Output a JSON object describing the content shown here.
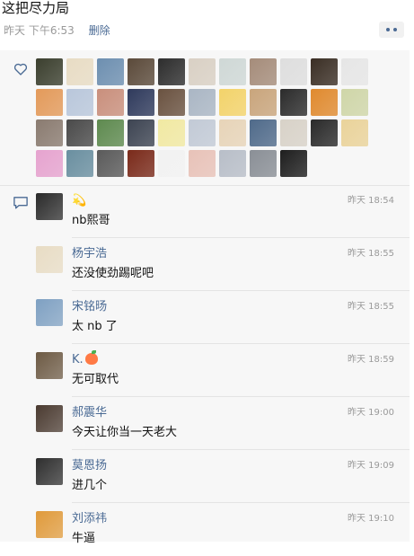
{
  "post": {
    "text": "这把尽力局",
    "time": "昨天 下午6:53",
    "delete_label": "删除"
  },
  "likes": {
    "icon": "heart-icon",
    "avatar_colors": [
      "#3b3f2e",
      "#e8dcc4",
      "#6d8fb0",
      "#5b4a3a",
      "#2d2d2d",
      "#d9d0c4",
      "#cfd8d6",
      "#a58c7a",
      "#dedede",
      "#3a2e24",
      "#e6e6e6",
      "#e39a5a",
      "#b9c7db",
      "#c98f7c",
      "#2f3a5c",
      "#6a5240",
      "#aab6c4",
      "#f3d36a",
      "#c9a57c",
      "#2b2b2b",
      "#e08a2e",
      "#cfd6a8",
      "#8a7b70",
      "#4a4a4a",
      "#5e8a4f",
      "#3d4452",
      "#f1e9a2",
      "#c2cad6",
      "#e7d4b8",
      "#4f6a8a",
      "#d8d2c8",
      "#2a2a2a",
      "#ead39a",
      "#e6a3cf",
      "#6a8fa0",
      "#5a5a5a",
      "#7a2a1a",
      "#f2f2f2",
      "#e8c2b8",
      "#b8bec8",
      "#8a8f96",
      "#1e1e1e"
    ]
  },
  "comments": [
    {
      "name": "💫",
      "time": "昨天 18:54",
      "text": "nb熙哥",
      "avatar_color": "#2a2a2a"
    },
    {
      "name": "杨宇浩",
      "time": "昨天 18:55",
      "text": "还没使劲踢呢吧",
      "avatar_color": "#e8dcc4"
    },
    {
      "name": "宋铭旸",
      "time": "昨天 18:55",
      "text": "太 nb 了",
      "avatar_color": "#7ea0c2"
    },
    {
      "name": "K.",
      "time": "昨天 18:59",
      "text": "无可取代",
      "avatar_color": "#6d5a44"
    },
    {
      "name": "郝震华",
      "time": "昨天 19:00",
      "text": "今天让你当一天老大",
      "avatar_color": "#4a3a30"
    },
    {
      "name": "莫恩扬",
      "time": "昨天 19:09",
      "text": "进几个",
      "avatar_color": "#2e2e2e"
    },
    {
      "name": "刘添祎",
      "time": "昨天 19:10",
      "text": "牛逼",
      "avatar_color": "#e09a3a"
    }
  ]
}
